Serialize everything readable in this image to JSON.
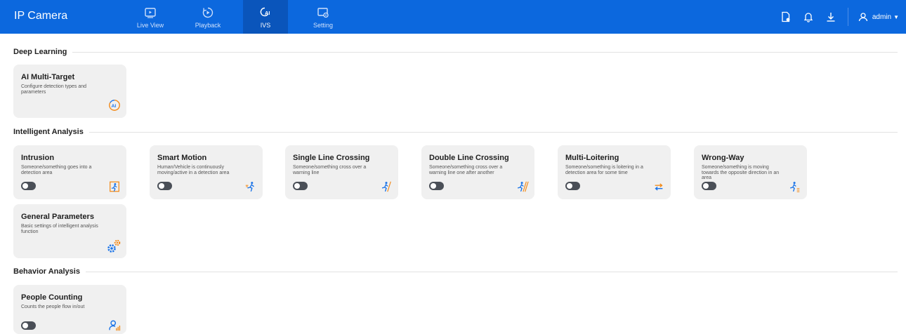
{
  "app": {
    "title": "IP Camera"
  },
  "nav": [
    {
      "label": "Live View",
      "icon": "live-view-icon"
    },
    {
      "label": "Playback",
      "icon": "playback-icon"
    },
    {
      "label": "IVS",
      "icon": "ivs-icon",
      "active": true
    },
    {
      "label": "Setting",
      "icon": "setting-icon"
    }
  ],
  "toolbar": {
    "user": "admin"
  },
  "sections": {
    "deep_learning": "Deep Learning",
    "intelligent_analysis": "Intelligent Analysis",
    "behavior_analysis": "Behavior Analysis"
  },
  "cards": {
    "ai_multi_target": {
      "title": "AI Multi-Target",
      "desc": "Configure detection types and parameters",
      "icon": "ai-icon"
    },
    "intrusion": {
      "title": "Intrusion",
      "desc": "Someone/something goes into a detection area",
      "icon": "intrusion-icon",
      "enabled": false
    },
    "smart_motion": {
      "title": "Smart Motion",
      "desc": "Human/Vehicle is continuously moving/active in a detection area",
      "icon": "running-person-icon",
      "enabled": false
    },
    "single_line": {
      "title": "Single Line Crossing",
      "desc": "Someone/something cross over a warning line",
      "icon": "line-crossing-icon",
      "enabled": false
    },
    "double_line": {
      "title": "Double Line Crossing",
      "desc": "Someone/something cross over a warning line one after another",
      "icon": "double-line-crossing-icon",
      "enabled": false
    },
    "multi_loitering": {
      "title": "Multi-Loitering",
      "desc": "Someone/something is loitering in a detection area for some time",
      "icon": "loitering-arrows-icon",
      "enabled": false
    },
    "wrong_way": {
      "title": "Wrong-Way",
      "desc": "Someone/something is moving towards the opposite direction in an area",
      "icon": "wrong-way-icon",
      "enabled": false
    },
    "general_params": {
      "title": "General Parameters",
      "desc": "Basic settings of intelligent analysis function",
      "icon": "gears-icon"
    },
    "people_counting": {
      "title": "People Counting",
      "desc": "Counts the people flow in/out",
      "icon": "people-counting-icon",
      "enabled": false
    }
  },
  "colors": {
    "header": "#0c68de",
    "active_tab": "#0a55bb",
    "icon_blue": "#1a73e8",
    "icon_orange": "#f28b1b",
    "toggle_off": "#4a4f57",
    "card_bg": "#f0f0f0"
  }
}
